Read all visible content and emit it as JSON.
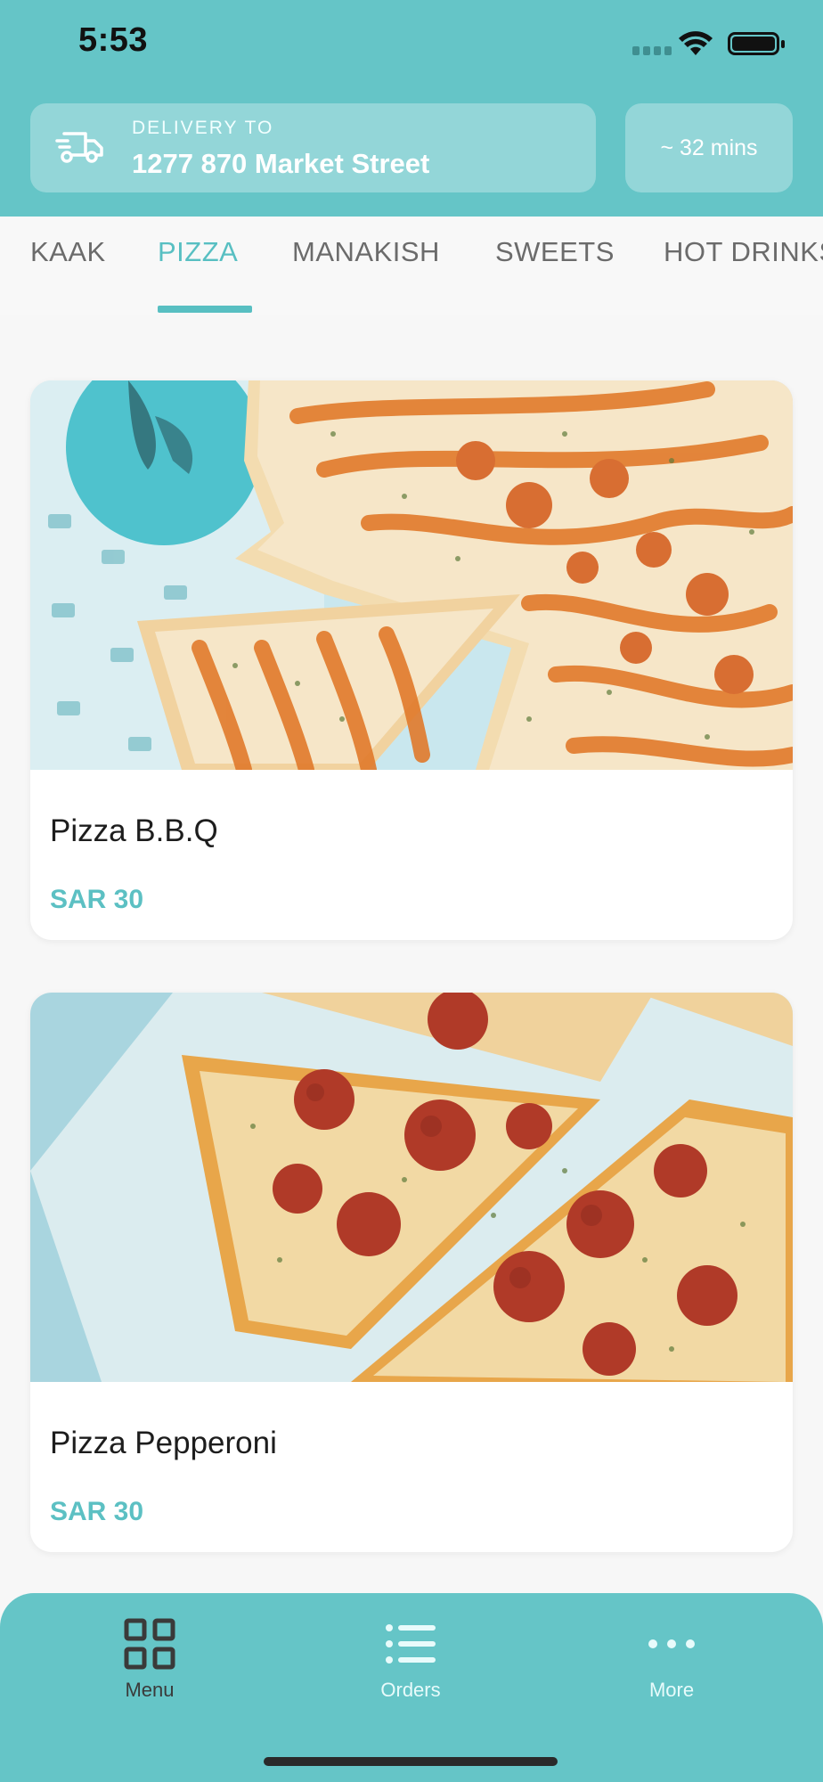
{
  "status_bar": {
    "time": "5:53"
  },
  "header": {
    "delivery_label": "DELIVERY TO",
    "delivery_address": "1277 870 Market Street",
    "eta": "~ 32 mins"
  },
  "tabs": [
    {
      "label": "KAAK",
      "active": false
    },
    {
      "label": "PIZZA",
      "active": true
    },
    {
      "label": "MANAKISH",
      "active": false
    },
    {
      "label": "SWEETS",
      "active": false
    },
    {
      "label": "HOT DRINKS",
      "active": false
    }
  ],
  "products": [
    {
      "name": "Pizza B.B.Q",
      "price": "SAR 30"
    },
    {
      "name": "Pizza Pepperoni",
      "price": "SAR 30"
    }
  ],
  "bottom_nav": {
    "menu": {
      "label": "Menu",
      "icon": "grid-icon",
      "active": true
    },
    "orders": {
      "label": "Orders",
      "icon": "list-icon",
      "active": false
    },
    "more": {
      "label": "More",
      "icon": "more-dots-icon",
      "active": false
    }
  },
  "colors": {
    "brand": "#65c5c7",
    "accent": "#58bfc2",
    "price": "#5cc0c3"
  }
}
